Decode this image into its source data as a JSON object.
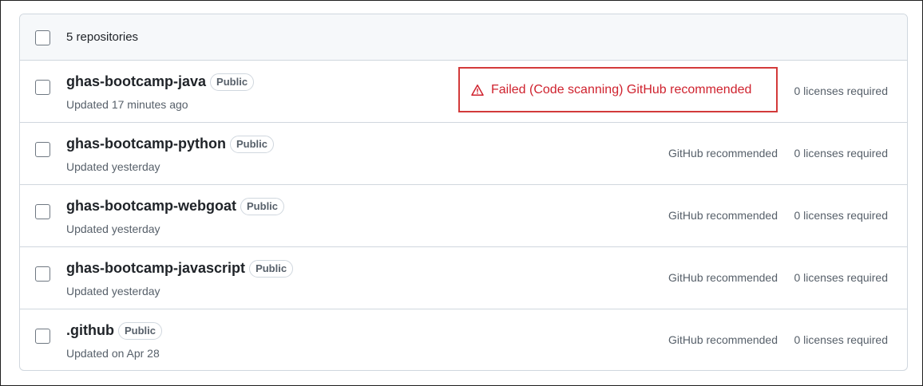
{
  "header": {
    "count_label": "5 repositories"
  },
  "repositories": [
    {
      "name": "ghas-bootcamp-java",
      "visibility": "Public",
      "updated": "Updated 17 minutes ago",
      "config": "Failed (Code scanning) GitHub recommended",
      "licenses": "0 licenses required",
      "status": "failed"
    },
    {
      "name": "ghas-bootcamp-python",
      "visibility": "Public",
      "updated": "Updated yesterday",
      "config": "GitHub recommended",
      "licenses": "0 licenses required",
      "status": "ok"
    },
    {
      "name": "ghas-bootcamp-webgoat",
      "visibility": "Public",
      "updated": "Updated yesterday",
      "config": "GitHub recommended",
      "licenses": "0 licenses required",
      "status": "ok"
    },
    {
      "name": "ghas-bootcamp-javascript",
      "visibility": "Public",
      "updated": "Updated yesterday",
      "config": "GitHub recommended",
      "licenses": "0 licenses required",
      "status": "ok"
    },
    {
      "name": ".github",
      "visibility": "Public",
      "updated": "Updated on Apr 28",
      "config": "GitHub recommended",
      "licenses": "0 licenses required",
      "status": "ok"
    }
  ],
  "colors": {
    "error": "#cf222e",
    "highlight_border": "#d33a3a",
    "muted": "#57606a",
    "border": "#d0d7de"
  },
  "icons": {
    "failed": "alert-triangle-icon"
  }
}
